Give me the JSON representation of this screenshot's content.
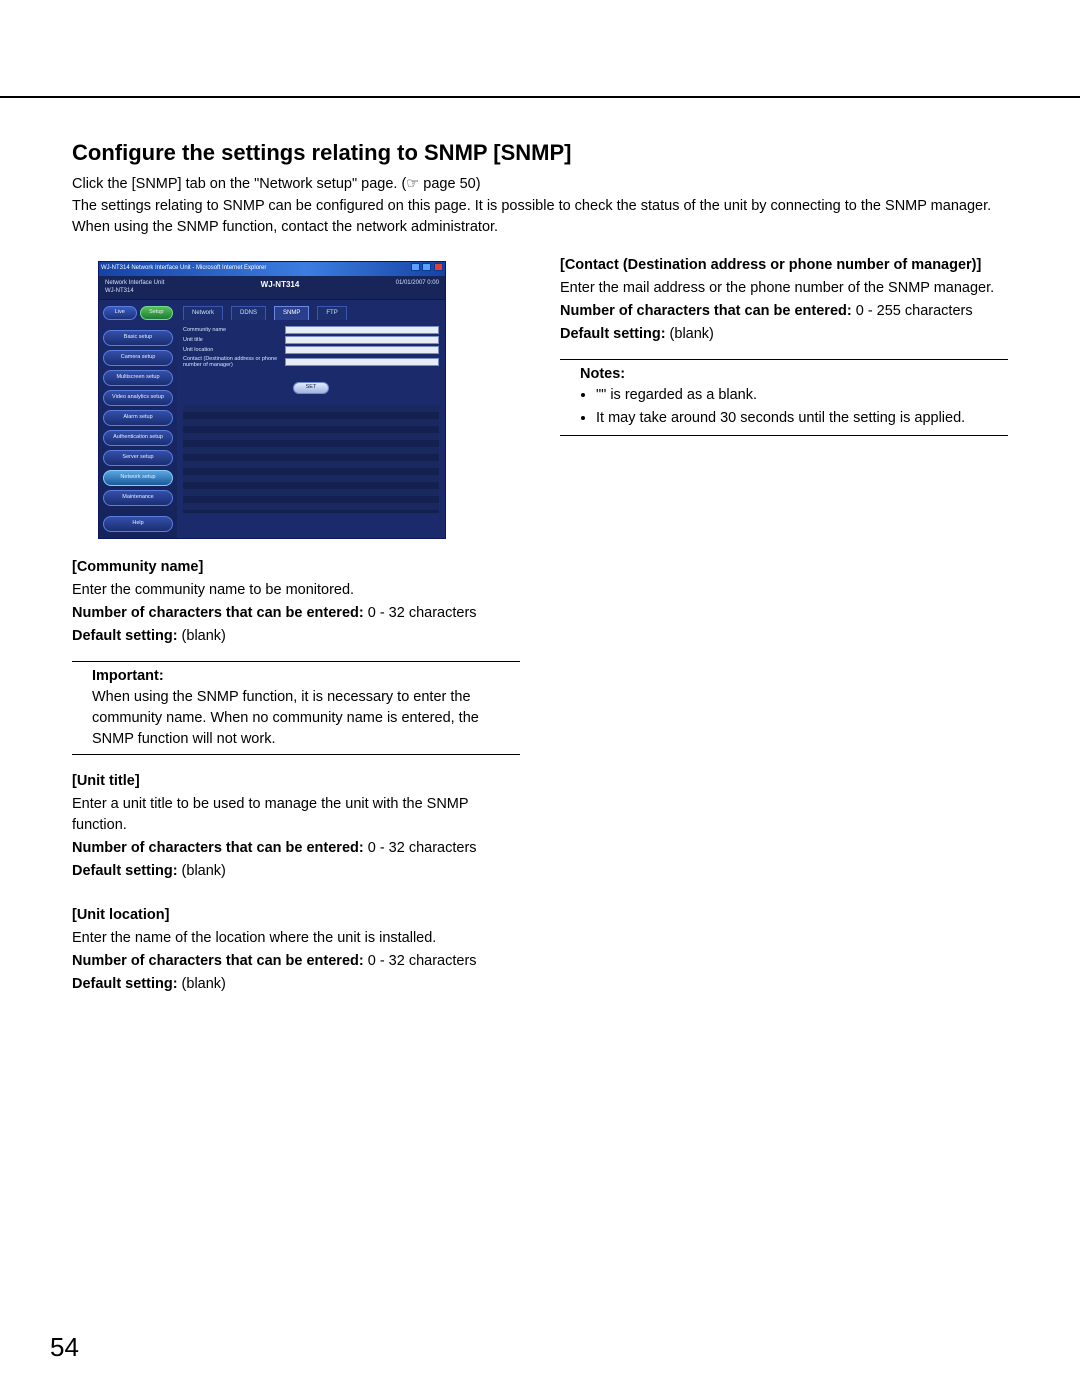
{
  "page_number": "54",
  "heading": "Configure the settings relating to SNMP [SNMP]",
  "intro_line1": "Click the [SNMP] tab on the \"Network setup\" page. (☞ page 50)",
  "intro_line2": "The settings relating to SNMP can be configured on this page. It is possible to check the status of the unit by connecting to the SNMP manager. When using the SNMP function, contact the network administrator.",
  "screenshot": {
    "window_title": "WJ-NT314 Network Interface Unit - Microsoft Internet Explorer",
    "header_small": "Network Interface Unit\nWJ-NT314",
    "header_title": "WJ-NT314",
    "header_date": "01/01/2007 0:00",
    "top_buttons": {
      "live": "Live",
      "setup": "Setup"
    },
    "nav": [
      "Basic setup",
      "Camera setup",
      "Multiscreen setup",
      "Video analytics setup",
      "Alarm setup",
      "Authentication setup",
      "Server setup",
      "Network setup",
      "Maintenance"
    ],
    "help": "Help",
    "tabs": [
      "Network",
      "DDNS",
      "SNMP",
      "FTP"
    ],
    "active_tab": "SNMP",
    "fields": {
      "community": "Community name",
      "unit_title": "Unit title",
      "unit_location": "Unit location",
      "contact": "Contact (Destination address or phone number of manager)"
    },
    "set_button": "SET"
  },
  "left": {
    "community": {
      "title": "[Community name]",
      "desc": "Enter the community name to be monitored.",
      "chars_label": "Number of characters that can be entered:",
      "chars_value": " 0 - 32 characters",
      "default_label": "Default setting:",
      "default_value": " (blank)"
    },
    "important": {
      "title": "Important:",
      "body": "When using the SNMP function, it is necessary to enter the community name. When no community name is entered, the SNMP function will not work."
    },
    "unit_title": {
      "title": "[Unit title]",
      "desc": "Enter a unit title to be used to manage the unit with the SNMP function.",
      "chars_label": "Number of characters that can be entered:",
      "chars_value": " 0 - 32 characters",
      "default_label": "Default setting:",
      "default_value": " (blank)"
    },
    "unit_location": {
      "title": "[Unit location]",
      "desc": "Enter the name of the location where the unit is installed.",
      "chars_label": "Number of characters that can be entered:",
      "chars_value": " 0 - 32 characters",
      "default_label": "Default setting:",
      "default_value": " (blank)"
    }
  },
  "right": {
    "contact": {
      "title": "[Contact (Destination address or phone number of manager)]",
      "desc": "Enter the mail address or the phone number of the SNMP manager.",
      "chars_label": "Number of characters that can be entered:",
      "chars_value": " 0 - 255 characters",
      "default_label": "Default setting:",
      "default_value": " (blank)"
    },
    "notes": {
      "title": "Notes:",
      "item1": "\"\" is regarded as a blank.",
      "item2": "It may take around 30 seconds until the setting is applied."
    }
  }
}
